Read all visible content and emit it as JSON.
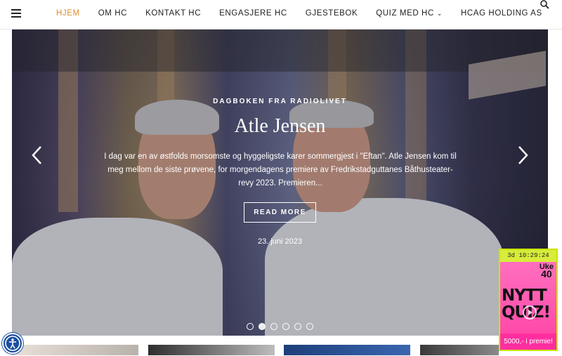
{
  "nav": {
    "items": [
      {
        "label": "HJEM"
      },
      {
        "label": "OM HC"
      },
      {
        "label": "KONTAKT HC"
      },
      {
        "label": "ENGASJERE HC"
      },
      {
        "label": "GJESTEBOK"
      },
      {
        "label": "QUIZ MED HC"
      },
      {
        "label": "HCAG HOLDING AS"
      }
    ],
    "active_color": "#e08a2a"
  },
  "slide": {
    "kicker": "DAGBOKEN FRA RADIOLIVET",
    "title": "Atle Jensen",
    "excerpt": "I dag var en av østfolds morsomste og hyggeligste karer sommergjest i \"Eftan\". Atle Jensen kom til meg mellom de siste prøvene, for morgendagens premiere av Fredrikstadguttanes Båthusteater-revy 2023. Premieren...",
    "read_more": "READ MORE",
    "date": "23. juni 2023",
    "total_dots": 6,
    "active_dot": 2
  },
  "quiz": {
    "timer": "3d 10:29:24",
    "week_label": "Uke",
    "week_number": "40",
    "headline_1": "NYTT",
    "headline_2": "QUIZ!",
    "prize": "5000,- i premie!",
    "accent": "#ff2ea0",
    "border": "#c8e600"
  }
}
